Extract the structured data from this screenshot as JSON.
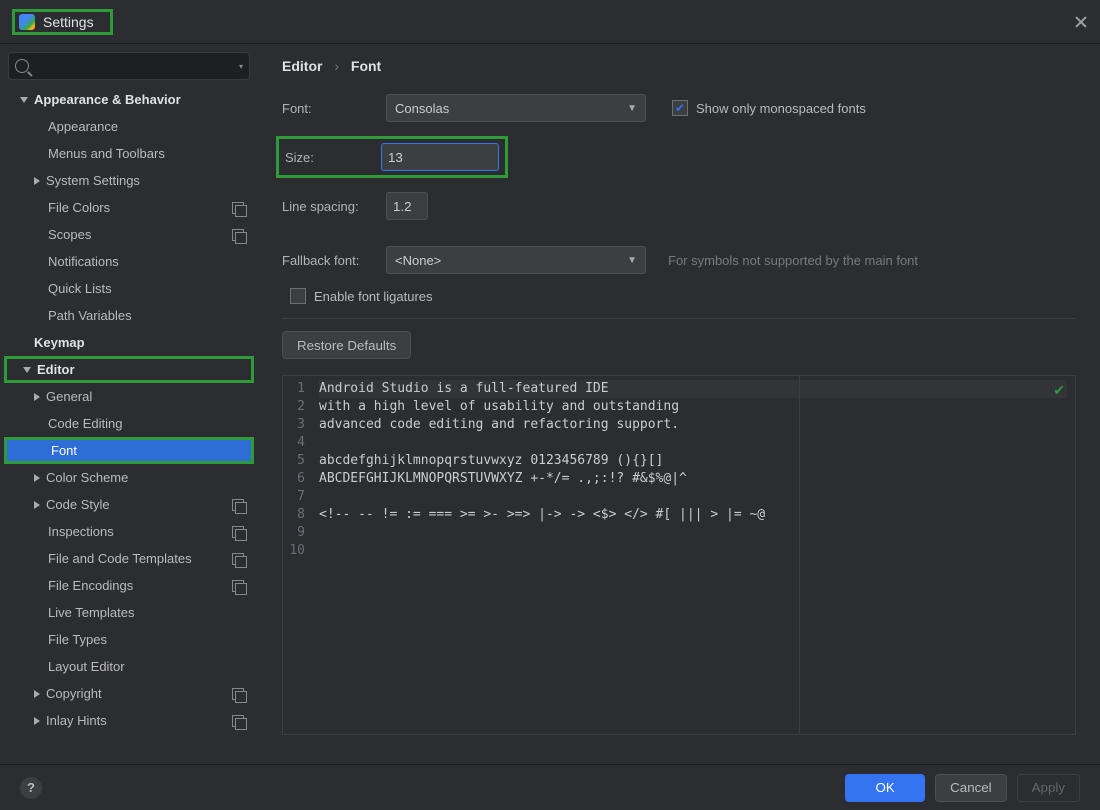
{
  "window": {
    "title": "Settings"
  },
  "search": {
    "placeholder": ""
  },
  "tree": {
    "appearance_behavior": "Appearance & Behavior",
    "appearance": "Appearance",
    "menus_toolbars": "Menus and Toolbars",
    "system_settings": "System Settings",
    "file_colors": "File Colors",
    "scopes": "Scopes",
    "notifications": "Notifications",
    "quick_lists": "Quick Lists",
    "path_variables": "Path Variables",
    "keymap": "Keymap",
    "editor": "Editor",
    "general": "General",
    "code_editing": "Code Editing",
    "font": "Font",
    "color_scheme": "Color Scheme",
    "code_style": "Code Style",
    "inspections": "Inspections",
    "file_code_templates": "File and Code Templates",
    "file_encodings": "File Encodings",
    "live_templates": "Live Templates",
    "file_types": "File Types",
    "layout_editor": "Layout Editor",
    "copyright": "Copyright",
    "inlay_hints": "Inlay Hints"
  },
  "breadcrumb": {
    "a": "Editor",
    "b": "Font"
  },
  "form": {
    "font_label": "Font:",
    "font_value": "Consolas",
    "monospaced_label": "Show only monospaced fonts",
    "monospaced_checked": true,
    "size_label": "Size:",
    "size_value": "13",
    "line_spacing_label": "Line spacing:",
    "line_spacing_value": "1.2",
    "fallback_label": "Fallback font:",
    "fallback_value": "<None>",
    "fallback_hint": "For symbols not supported by the main font",
    "ligatures_label": "Enable font ligatures",
    "restore_button": "Restore Defaults"
  },
  "preview": {
    "lines": [
      "Android Studio is a full-featured IDE",
      "with a high level of usability and outstanding",
      "advanced code editing and refactoring support.",
      "",
      "abcdefghijklmnopqrstuvwxyz 0123456789 (){}[]",
      "ABCDEFGHIJKLMNOPQRSTUVWXYZ +-*/= .,;:!? #&$%@|^",
      "",
      "<!-- -- != := === >= >- >=> |-> -> <$> </> #[ ||| > |= ~@",
      "",
      ""
    ]
  },
  "footer": {
    "ok": "OK",
    "cancel": "Cancel",
    "apply": "Apply"
  }
}
